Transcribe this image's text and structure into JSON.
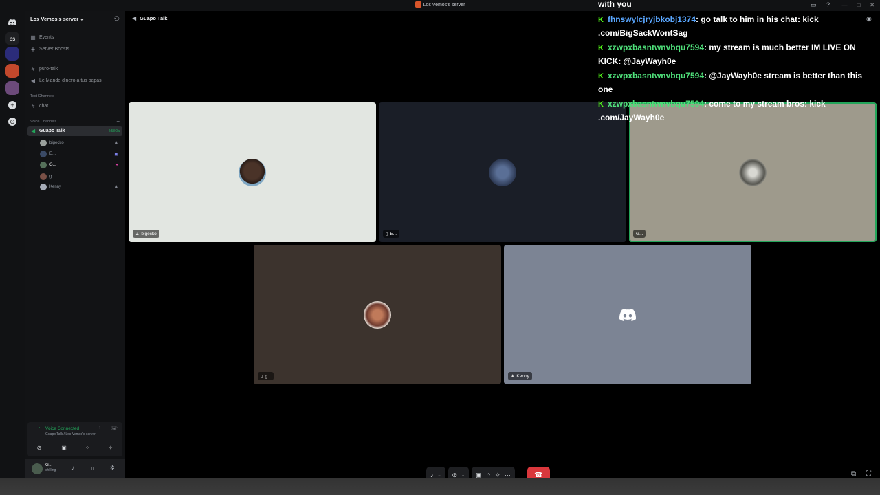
{
  "window": {
    "title": "Los Vemos's server",
    "controls": [
      "—",
      "□",
      "✕"
    ]
  },
  "rail": {
    "home_label": "bs"
  },
  "server": {
    "name": "Los Vemos's server ⌄",
    "items": [
      {
        "icon": "calendar-icon",
        "glyph": "▦",
        "label": "Events"
      },
      {
        "icon": "boost-icon",
        "glyph": "◈",
        "label": "Server Boosts"
      },
      {
        "icon": "hash-icon",
        "glyph": "#",
        "label": "puro-talk"
      },
      {
        "icon": "speaker-icon",
        "glyph": "◀",
        "label": "Le Mande dinero a tus papas"
      }
    ],
    "text_category": "Text Channels",
    "text_channels": [
      {
        "label": "chat"
      }
    ],
    "voice_category": "Voice Channels",
    "active_voice": {
      "label": "Guapo Talk",
      "time": "4:58:0a"
    },
    "voice_users": [
      {
        "name": "bigecko",
        "color": "#9aa09c"
      },
      {
        "name": "E...",
        "color": "#3a4a66"
      },
      {
        "name": "G...",
        "color": "#55705a"
      },
      {
        "name": "g...",
        "color": "#7a5046"
      },
      {
        "name": "Kenny",
        "color": "#a7adb8"
      }
    ]
  },
  "voice_panel": {
    "title": "Voice Connected",
    "subtitle": "Guapo Talk / Los Vemos's server"
  },
  "user_panel": {
    "name": "G...",
    "status": "chilling"
  },
  "main": {
    "channel": "Guapo Talk",
    "tiles": [
      {
        "name": "bigecko",
        "bg": "#e2e6e1",
        "avatar": "#4a3328"
      },
      {
        "name": "E...",
        "bg": "#1a1e27",
        "avatar": "#3b4e6e"
      },
      {
        "name": "G...",
        "bg": "#9e9a8c",
        "avatar": "#6f6f6a"
      },
      {
        "name": "g...",
        "bg": "#3c332d",
        "avatar": "#8a5a48"
      },
      {
        "name": "Kenny",
        "bg": "#7c8494",
        "avatar": null
      }
    ]
  },
  "chat": {
    "fragment": "with you",
    "messages": [
      {
        "user": "fhnswylcjryjbkobj1374",
        "text": ": go talk to him in his chat: kick .com/BigSackWontSag"
      },
      {
        "user": "xzwpxbasntwnvbqu7594",
        "text": ": my stream is much better IM LIVE ON KICK: @JayWayh0e"
      },
      {
        "user": "xzwpxbasntwnvbqu7594",
        "text": ": @JayWayh0e stream is better than this one"
      },
      {
        "user": "xzwpxbasntwnvbqu7594",
        "text": ": come to my stream bros: kick .com/JayWayh0e"
      }
    ]
  }
}
